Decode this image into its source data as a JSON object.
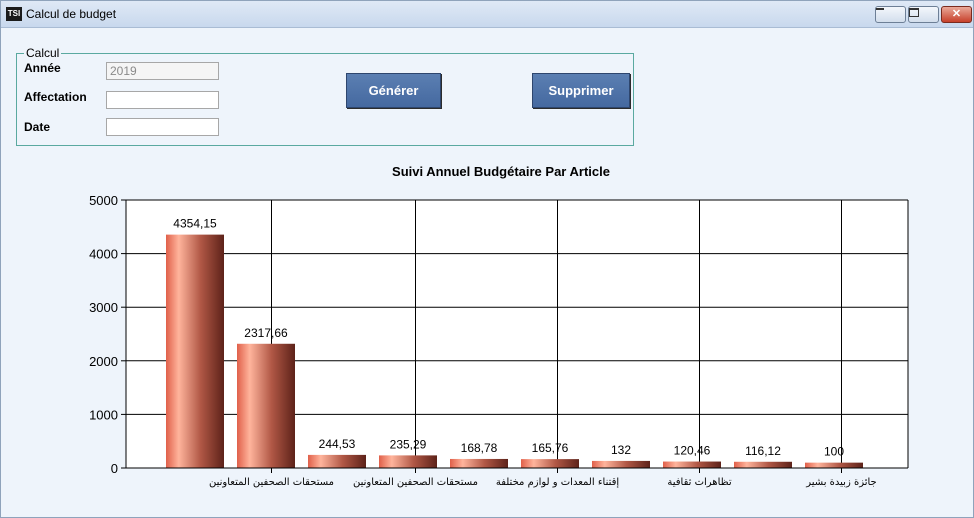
{
  "window": {
    "title": "Calcul de budget",
    "icon_label": "TSI"
  },
  "form": {
    "group_label": "Calcul",
    "annee_label": "Année",
    "annee_value": "2019",
    "affectation_label": "Affectation",
    "affectation_value": "",
    "date_label": "Date",
    "date_value": "",
    "generer_label": "Générer",
    "supprimer_label": "Supprimer"
  },
  "chart_data": {
    "type": "bar",
    "title": "Suivi Annuel Budgétaire Par Article",
    "xlabel": "",
    "ylabel": "",
    "ylim": [
      0,
      5000
    ],
    "yticks": [
      0,
      1000,
      2000,
      3000,
      4000,
      5000
    ],
    "values": [
      4354.15,
      2317.66,
      244.53,
      235.29,
      168.78,
      165.76,
      132,
      120.46,
      116.12,
      100
    ],
    "value_labels": [
      "4354,15",
      "2317,66",
      "244,53",
      "235,29",
      "168,78",
      "165,76",
      "132",
      "120,46",
      "116,12",
      "100"
    ],
    "x_tick_labels": [
      {
        "after_bar": 2,
        "text": "مستحقات الصحفين المتعاونين"
      },
      {
        "after_bar": 4,
        "text": "مستحقات الصحفين المتعاونين"
      },
      {
        "after_bar": 6,
        "text": "إقتناء المعدات و لوازم مختلفة"
      },
      {
        "after_bar": 8,
        "text": "تظاهرات ثقافية"
      },
      {
        "after_bar": 10,
        "text": "جائزة زبيدة بشير"
      }
    ],
    "grid": true,
    "bar_color_light": "#ffa890",
    "bar_color_dark": "#6b2a20"
  }
}
